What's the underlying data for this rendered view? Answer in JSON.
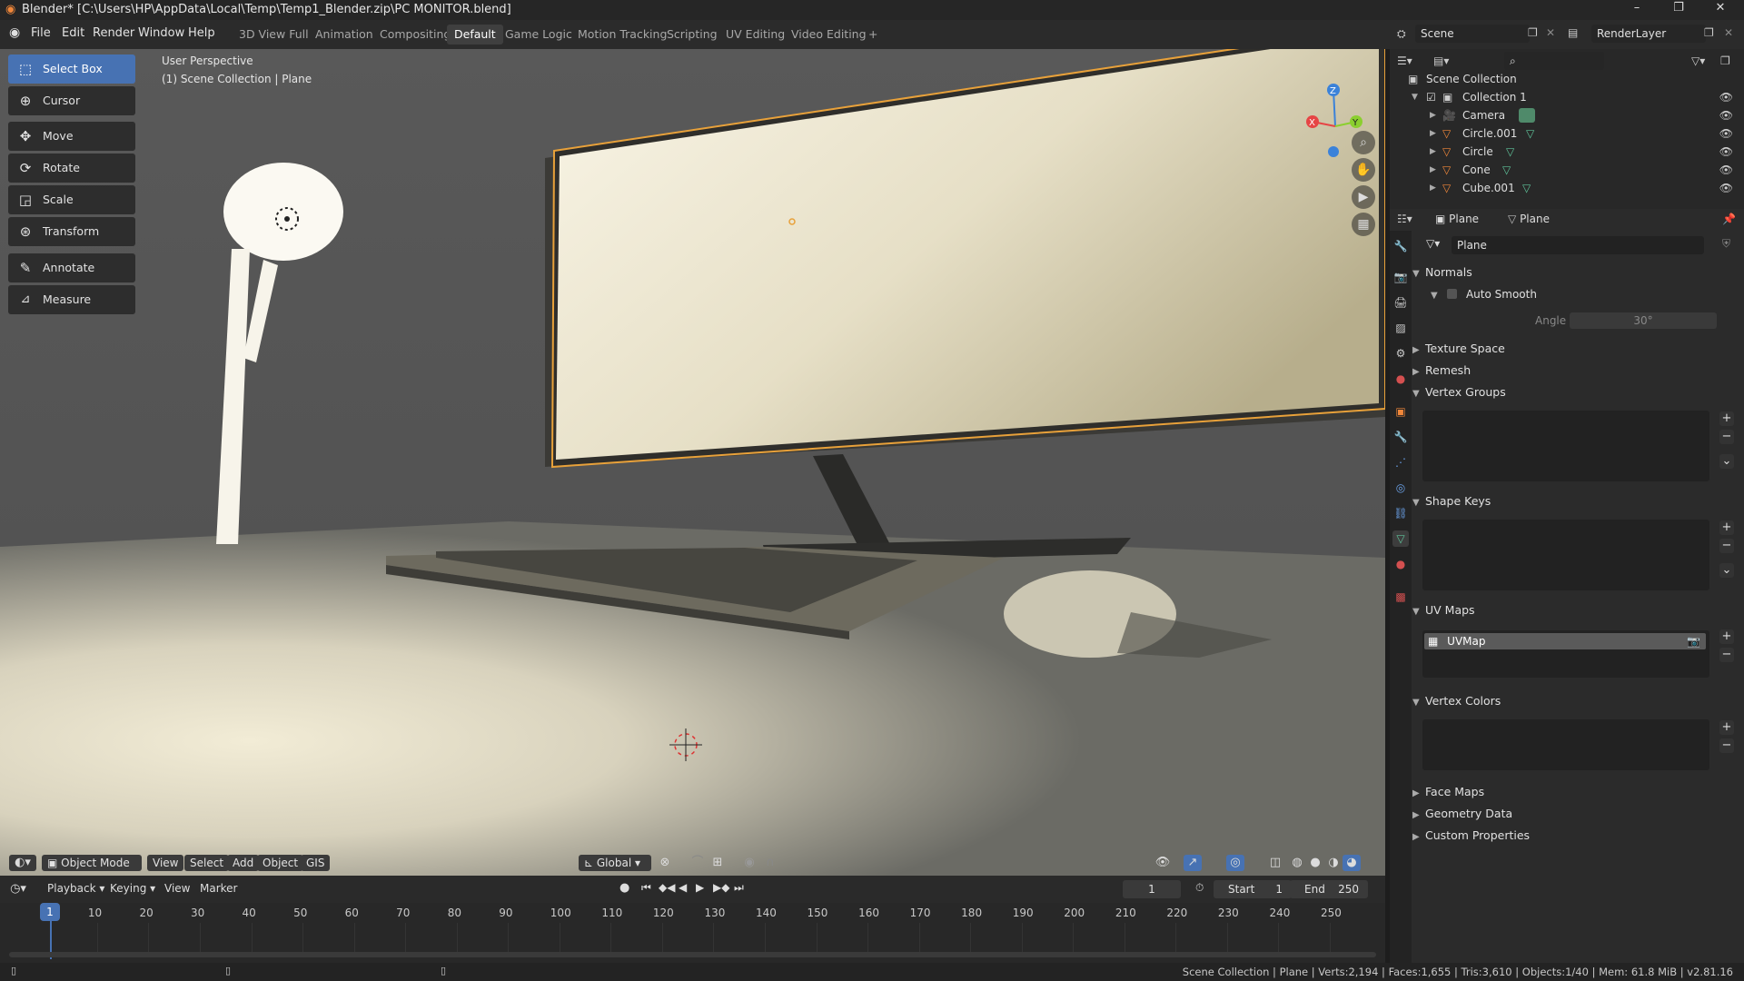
{
  "window": {
    "title": "Blender* [C:\\Users\\HP\\AppData\\Local\\Temp\\Temp1_Blender.zip\\PC MONITOR.blend]",
    "minimize": "–",
    "restore": "❐",
    "close": "✕"
  },
  "menu": {
    "file": "File",
    "edit": "Edit",
    "render": "Render",
    "window": "Window",
    "help": "Help"
  },
  "workspaces": [
    "3D View Full",
    "Animation",
    "Compositing",
    "Default",
    "Game Logic",
    "Motion Tracking",
    "Scripting",
    "UV Editing",
    "Video Editing",
    "+"
  ],
  "active_workspace": "Default",
  "scene_selector": {
    "scene": "Scene",
    "render_layer": "RenderLayer"
  },
  "viewport": {
    "perspective": "User Perspective",
    "collection_info": "(1) Scene Collection | Plane",
    "gizmo_axes": {
      "x": "X",
      "y": "Y",
      "z": "Z"
    }
  },
  "tools": [
    {
      "label": "Select Box",
      "icon": "select-box-icon",
      "glyph": "⬚",
      "active": true
    },
    {
      "label": "Cursor",
      "icon": "cursor-icon",
      "glyph": "⊕",
      "active": false
    },
    {
      "label": "Move",
      "icon": "move-icon",
      "glyph": "✥",
      "active": false
    },
    {
      "label": "Rotate",
      "icon": "rotate-icon",
      "glyph": "⟳",
      "active": false
    },
    {
      "label": "Scale",
      "icon": "scale-icon",
      "glyph": "◲",
      "active": false
    },
    {
      "label": "Transform",
      "icon": "transform-icon",
      "glyph": "⊛",
      "active": false
    },
    {
      "label": "Annotate",
      "icon": "annotate-icon",
      "glyph": "✎",
      "active": false
    },
    {
      "label": "Measure",
      "icon": "measure-icon",
      "glyph": "📐",
      "active": false
    }
  ],
  "viewport_header": {
    "mode": "Object Mode",
    "view": "View",
    "select": "Select",
    "add": "Add",
    "object": "Object",
    "gis": "GIS",
    "orientation": "Global"
  },
  "timeline": {
    "playback": "Playback",
    "keying": "Keying",
    "view": "View",
    "marker": "Marker",
    "current_frame": "1",
    "start_label": "Start",
    "start": "1",
    "end_label": "End",
    "end": "250",
    "ticks": [
      "1",
      "10",
      "20",
      "30",
      "40",
      "50",
      "60",
      "70",
      "80",
      "90",
      "100",
      "110",
      "120",
      "130",
      "140",
      "150",
      "160",
      "170",
      "180",
      "190",
      "200",
      "210",
      "220",
      "230",
      "240",
      "250"
    ]
  },
  "outliner": {
    "root": "Scene Collection",
    "collection": "Collection 1",
    "items": [
      "Camera",
      "Circle.001",
      "Circle",
      "Cone",
      "Cube.001"
    ]
  },
  "properties": {
    "object_name": "Plane",
    "data_name": "Plane",
    "mesh_name": "Plane",
    "panels": {
      "normals": "Normals",
      "auto_smooth": "Auto Smooth",
      "angle_label": "Angle",
      "angle_value": "30°",
      "texture_space": "Texture Space",
      "remesh": "Remesh",
      "vertex_groups": "Vertex Groups",
      "shape_keys": "Shape Keys",
      "uv_maps": "UV Maps",
      "uv_map_item": "UVMap",
      "vertex_colors": "Vertex Colors",
      "face_maps": "Face Maps",
      "geometry_data": "Geometry Data",
      "custom_properties": "Custom Properties"
    }
  },
  "status": "Scene Collection | Plane | Verts:2,194 | Faces:1,655 | Tris:3,610 | Objects:1/40 | Mem: 61.8 MiB | v2.81.16",
  "colors": {
    "accent": "#4772b3",
    "bg": "#2b2b2b",
    "selected_outline": "#e8a13a",
    "x_axis": "#e64545",
    "y_axis": "#8bcf2f",
    "z_axis": "#3b82d9"
  }
}
